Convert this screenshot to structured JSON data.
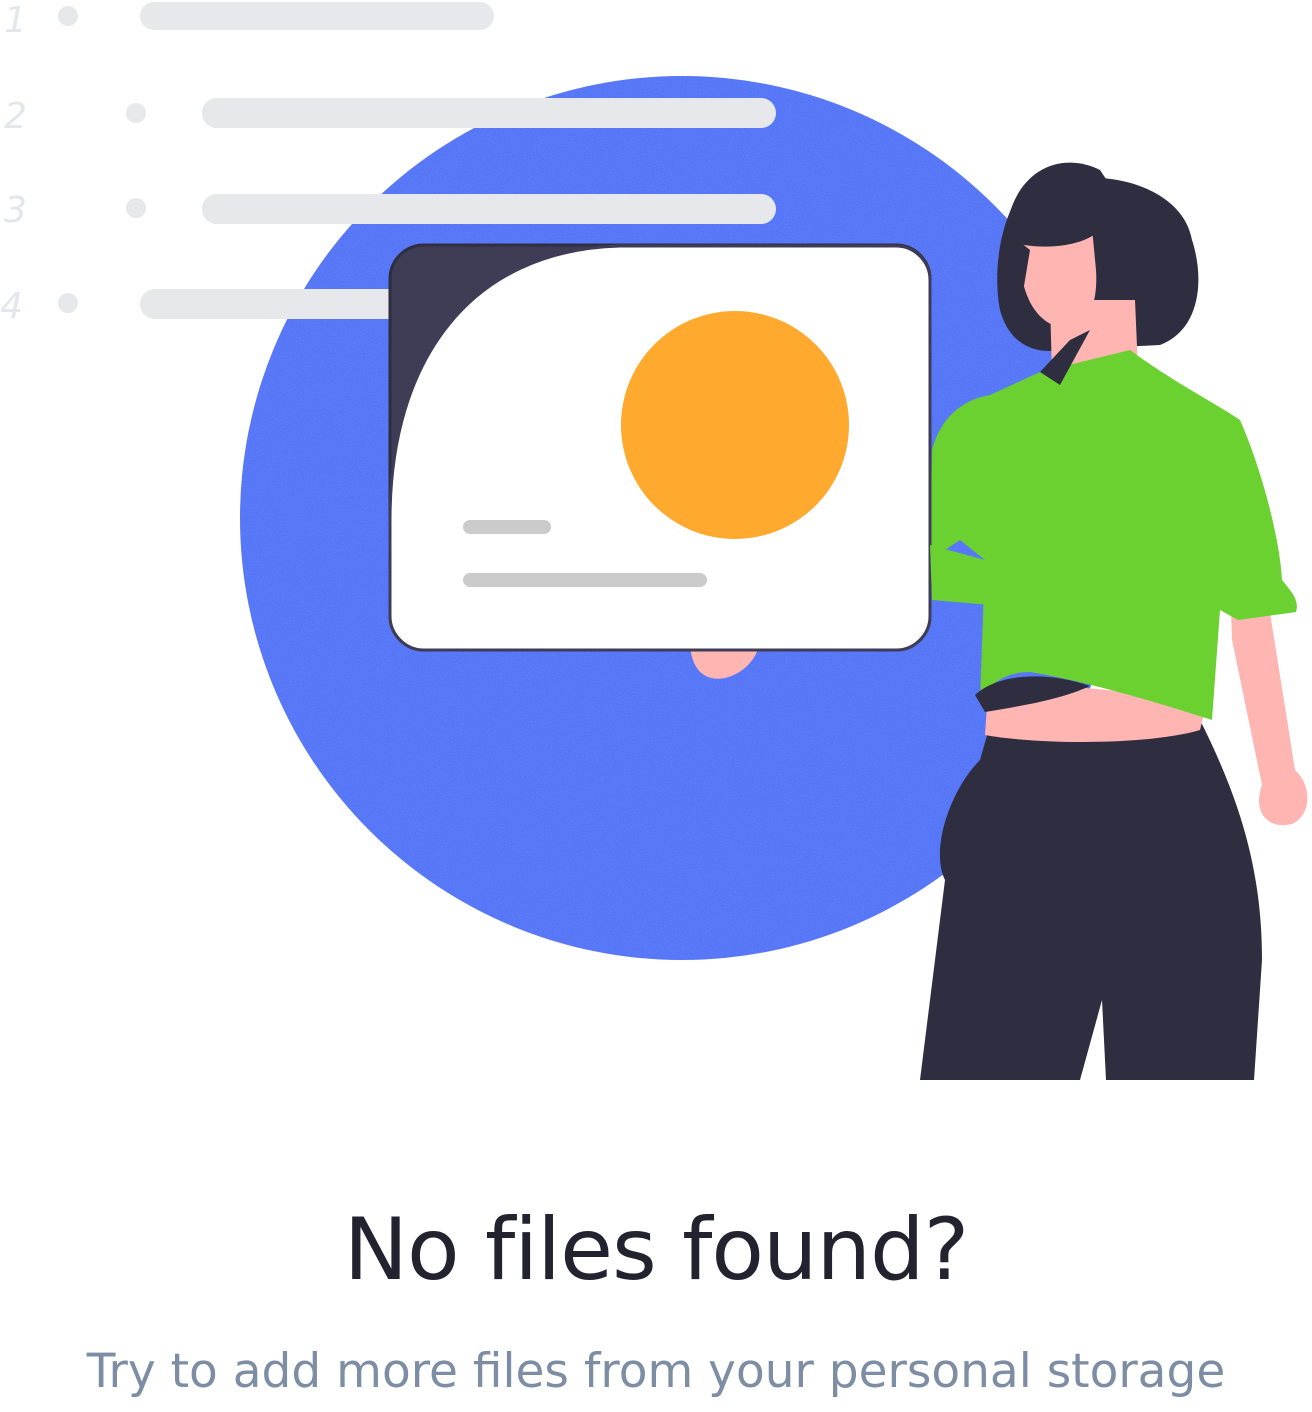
{
  "empty_state": {
    "title": "No files found?",
    "subtitle": "Try to add more files from your personal storage"
  },
  "illustration": {
    "list_numbers": [
      "1",
      "2",
      "3",
      "4"
    ],
    "colors": {
      "circle": "#4a6cf7",
      "sun": "#ffa92e",
      "shirt": "#6bd130",
      "dark": "#2f2e41",
      "skin": "#ffb6b3",
      "bars": "#e6e8ec",
      "card": "#ffffff"
    }
  }
}
